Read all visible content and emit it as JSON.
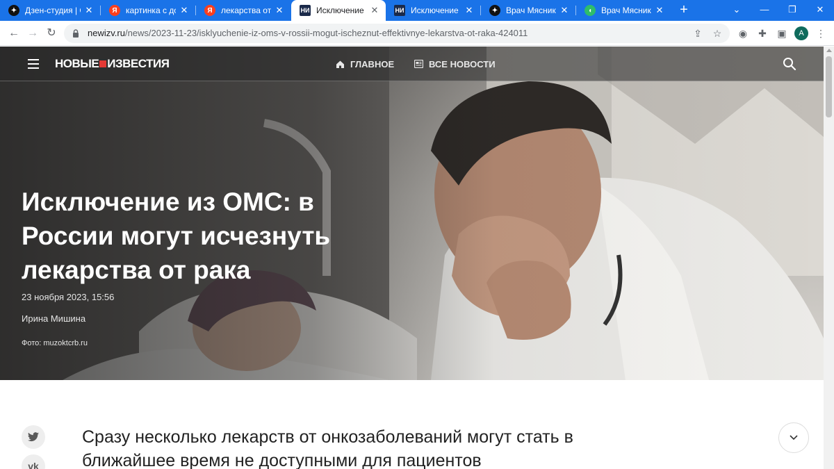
{
  "browser": {
    "tabs": [
      {
        "title": "Дзен-студия | Ст",
        "favicon": "dzen-icon",
        "active": false
      },
      {
        "title": "картинка с добр",
        "favicon": "yandex-icon",
        "active": false
      },
      {
        "title": "лекарства от ра",
        "favicon": "yandex-icon",
        "active": false
      },
      {
        "title": "Исключение из",
        "favicon": "newizv-icon",
        "active": true
      },
      {
        "title": "Исключение из",
        "favicon": "newizv-icon",
        "active": false
      },
      {
        "title": "Врач Мясников",
        "favicon": "dzen-icon",
        "active": false
      },
      {
        "title": "Врач Мясников",
        "favicon": "chat-icon",
        "active": false
      }
    ],
    "new_tab_label": "+",
    "address": {
      "host": "newizv.ru",
      "path": "/news/2023-11-23/isklyuchenie-iz-oms-v-rossii-mogut-ischeznut-effektivnye-lekarstva-ot-raka-424011"
    },
    "profile_initial": "A",
    "accent_color": "#1a73e8"
  },
  "site": {
    "logo_left": "НОВЫЕ",
    "logo_right": "ИЗВЕСТИЯ",
    "nav": {
      "home": "ГЛАВНОЕ",
      "all_news": "ВСЕ НОВОСТИ"
    }
  },
  "article": {
    "headline": "Исключение из ОМС: в России могут исчезнуть лекарства от рака",
    "date": "23 ноября 2023, 15:56",
    "author": "Ирина Мишина",
    "photo_credit": "Фото: muzoktcrb.ru",
    "lead": "Сразу несколько лекарств от онкозаболеваний могут стать в ближайшее время не доступными для пациентов"
  },
  "share": {
    "twitter": "twitter-icon",
    "vk": "vk-icon",
    "vk_label": "vk"
  }
}
